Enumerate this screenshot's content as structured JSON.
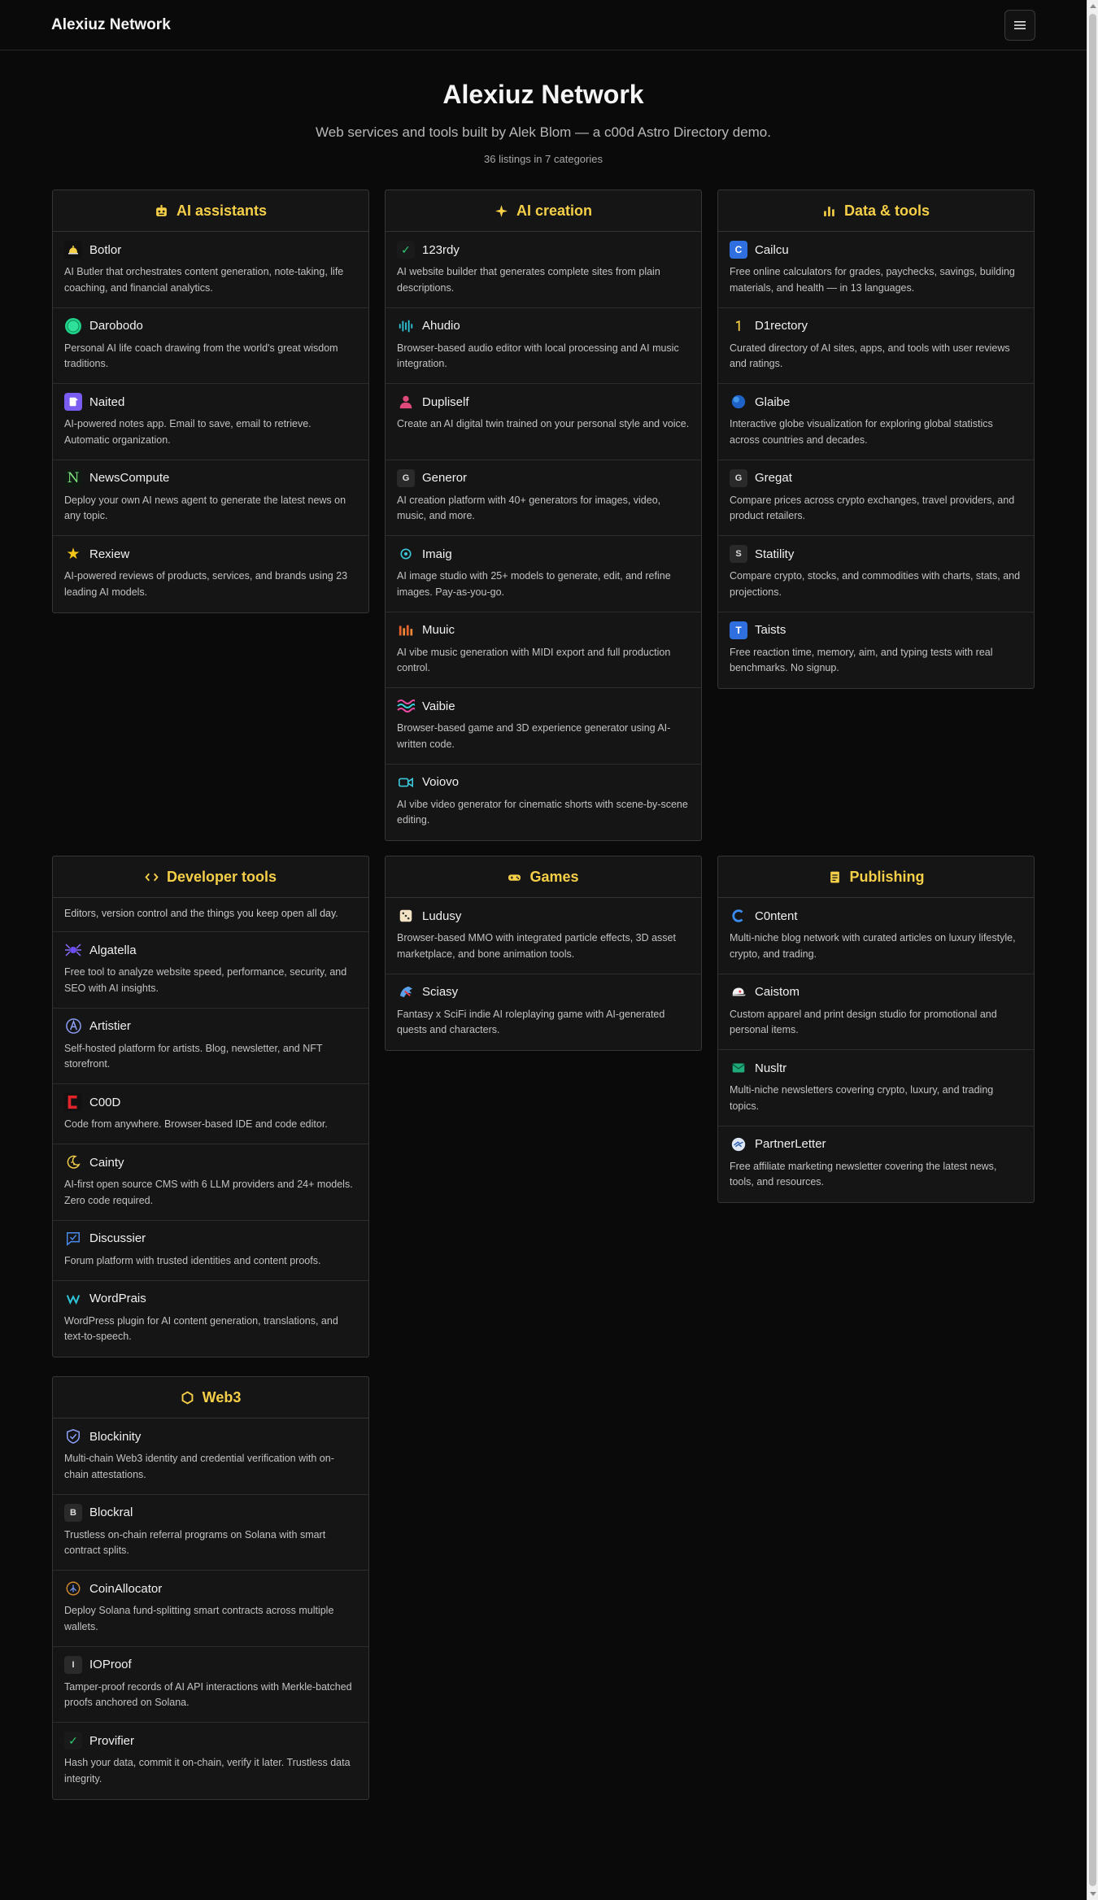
{
  "header": {
    "brand": "Alexiuz Network"
  },
  "hero": {
    "title": "Alexiuz Network",
    "subtitle": "Web services and tools built by Alek Blom — a c00d Astro Directory demo.",
    "count": "36 listings in 7 categories"
  },
  "colors": {
    "accent": "#f5cf48",
    "background": "#0a0a0a",
    "card": "#151515"
  },
  "categories": [
    {
      "title": "AI assistants",
      "icon": "robot-icon",
      "items": [
        {
          "name": "Botlor",
          "icon": "bell-icon",
          "desc": "AI Butler that orchestrates content generation, note-taking, life coaching, and financial analytics."
        },
        {
          "name": "Darobodo",
          "icon": "circle-icon",
          "desc": "Personal AI life coach drawing from the world's great wisdom traditions."
        },
        {
          "name": "Naited",
          "icon": "notes-icon",
          "desc": "AI-powered notes app. Email to save, email to retrieve. Automatic organization."
        },
        {
          "name": "NewsCompute",
          "icon": "n-letter-icon",
          "desc": "Deploy your own AI news agent to generate the latest news on any topic."
        },
        {
          "name": "Rexiew",
          "icon": "star-icon",
          "desc": "AI-powered reviews of products, services, and brands using 23 leading AI models."
        }
      ]
    },
    {
      "title": "AI creation",
      "icon": "sparkle-icon",
      "items": [
        {
          "name": "123rdy",
          "icon": "check-icon",
          "desc": "AI website builder that generates complete sites from plain descriptions."
        },
        {
          "name": "Ahudio",
          "icon": "waveform-icon",
          "desc": "Browser-based audio editor with local processing and AI music integration."
        },
        {
          "name": "Dupliself",
          "icon": "person-icon",
          "desc": "Create an AI digital twin trained on your personal style and voice."
        },
        {
          "name": "Generor",
          "icon": "g-letter-icon",
          "desc": "AI creation platform with 40+ generators for images, video, music, and more."
        },
        {
          "name": "Imaig",
          "icon": "target-icon",
          "desc": "AI image studio with 25+ models to generate, edit, and refine images. Pay-as-you-go."
        },
        {
          "name": "Muuic",
          "icon": "bars-icon",
          "desc": "AI vibe music generation with MIDI export and full production control."
        },
        {
          "name": "Vaibie",
          "icon": "waves-icon",
          "desc": "Browser-based game and 3D experience generator using AI-written code."
        },
        {
          "name": "Voiovo",
          "icon": "video-camera-icon",
          "desc": "AI vibe video generator for cinematic shorts with scene-by-scene editing."
        }
      ]
    },
    {
      "title": "Data & tools",
      "icon": "bar-chart-icon",
      "items": [
        {
          "name": "Cailcu",
          "icon": "c-letter-icon",
          "letter": "C",
          "desc": "Free online calculators for grades, paychecks, savings, building materials, and health — in 13 languages."
        },
        {
          "name": "D1rectory",
          "icon": "one-icon",
          "desc": "Curated directory of AI sites, apps, and tools with user reviews and ratings."
        },
        {
          "name": "Glaibe",
          "icon": "globe-icon",
          "desc": "Interactive globe visualization for exploring global statistics across countries and decades."
        },
        {
          "name": "Gregat",
          "icon": "g-letter-icon",
          "letter": "G",
          "desc": "Compare prices across crypto exchanges, travel providers, and product retailers."
        },
        {
          "name": "Statility",
          "icon": "s-letter-icon",
          "letter": "S",
          "desc": "Compare crypto, stocks, and commodities with charts, stats, and projections."
        },
        {
          "name": "Taists",
          "icon": "t-letter-icon",
          "letter": "T",
          "desc": "Free reaction time, memory, aim, and typing tests with real benchmarks. No signup."
        }
      ]
    },
    {
      "title": "Developer tools",
      "icon": "code-icon",
      "description": "Editors, version control and the things you keep open all day.",
      "items": [
        {
          "name": "Algatella",
          "icon": "spider-icon",
          "desc": "Free tool to analyze website speed, performance, security, and SEO with AI insights."
        },
        {
          "name": "Artistier",
          "icon": "a-circle-icon",
          "desc": "Self-hosted platform for artists. Blog, newsletter, and NFT storefront."
        },
        {
          "name": "C00D",
          "icon": "c00d-icon",
          "desc": "Code from anywhere. Browser-based IDE and code editor."
        },
        {
          "name": "Cainty",
          "icon": "moon-icon",
          "desc": "AI-first open source CMS with 6 LLM providers and 24+ models. Zero code required."
        },
        {
          "name": "Discussier",
          "icon": "chat-check-icon",
          "desc": "Forum platform with trusted identities and content proofs."
        },
        {
          "name": "WordPrais",
          "icon": "w-icon",
          "desc": "WordPress plugin for AI content generation, translations, and text-to-speech."
        }
      ]
    },
    {
      "title": "Games",
      "icon": "gamepad-icon",
      "items": [
        {
          "name": "Ludusy",
          "icon": "dice-icon",
          "desc": "Browser-based MMO with integrated particle effects, 3D asset marketplace, and bone animation tools."
        },
        {
          "name": "Sciasy",
          "icon": "dragon-icon",
          "desc": "Fantasy x SciFi indie AI roleplaying game with AI-generated quests and characters."
        }
      ]
    },
    {
      "title": "Publishing",
      "icon": "document-icon",
      "items": [
        {
          "name": "C0ntent",
          "icon": "c-ring-icon",
          "desc": "Multi-niche blog network with curated articles on luxury lifestyle, crypto, and trading."
        },
        {
          "name": "Caistom",
          "icon": "cap-icon",
          "desc": "Custom apparel and print design studio for promotional and personal items."
        },
        {
          "name": "Nusltr",
          "icon": "mail-icon",
          "desc": "Multi-niche newsletters covering crypto, luxury, and trading topics."
        },
        {
          "name": "PartnerLetter",
          "icon": "handshake-icon",
          "desc": "Free affiliate marketing newsletter covering the latest news, tools, and resources."
        }
      ]
    },
    {
      "title": "Web3",
      "icon": "hexagon-icon",
      "items": [
        {
          "name": "Blockinity",
          "icon": "shield-icon",
          "desc": "Multi-chain Web3 identity and credential verification with on-chain attestations."
        },
        {
          "name": "Blockral",
          "icon": "b-letter-icon",
          "letter": "B",
          "desc": "Trustless on-chain referral programs on Solana with smart contract splits."
        },
        {
          "name": "CoinAllocator",
          "icon": "coin-icon",
          "desc": "Deploy Solana fund-splitting smart contracts across multiple wallets."
        },
        {
          "name": "IOProof",
          "icon": "i-letter-icon",
          "letter": "I",
          "desc": "Tamper-proof records of AI API interactions with Merkle-batched proofs anchored on Solana."
        },
        {
          "name": "Provifier",
          "icon": "check-icon",
          "desc": "Hash your data, commit it on-chain, verify it later. Trustless data integrity."
        }
      ]
    }
  ]
}
